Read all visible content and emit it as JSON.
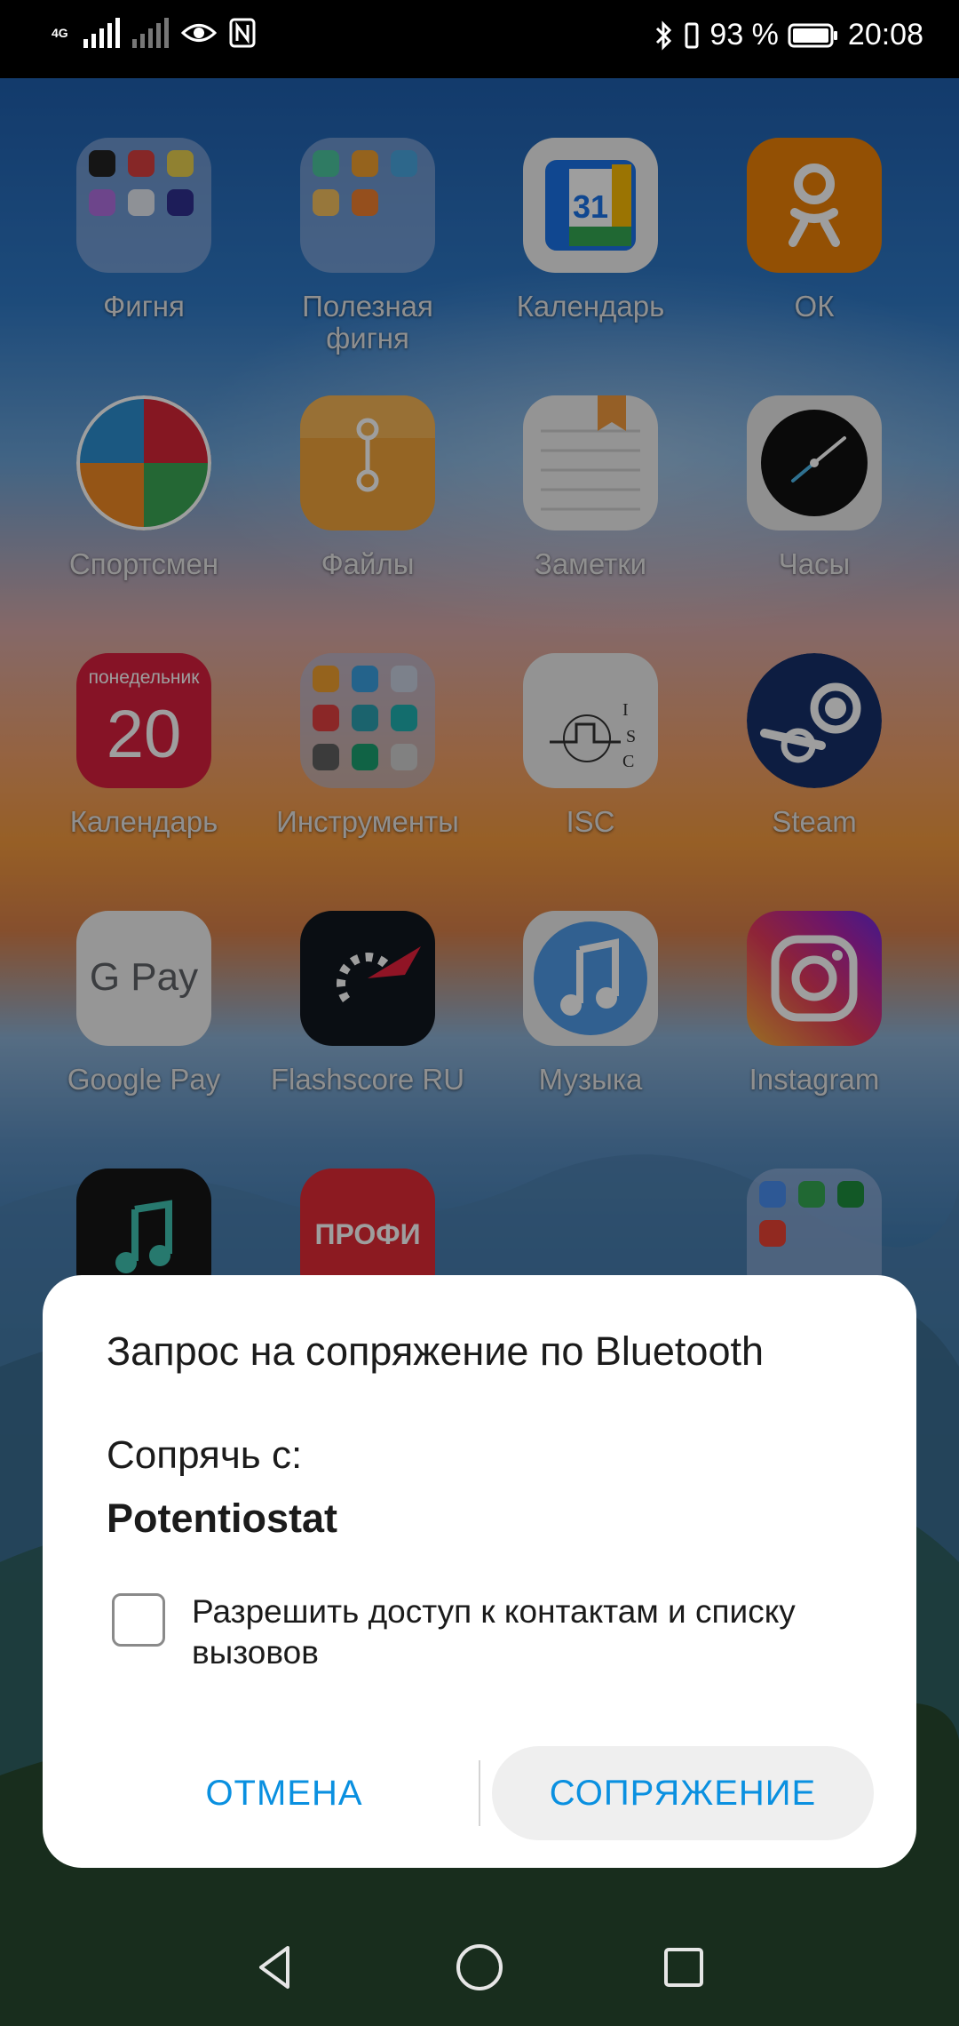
{
  "status_bar": {
    "network_type": "4G",
    "battery_percent": "93 %",
    "time": "20:08",
    "icons": [
      "signal-icon",
      "no-signal-icon",
      "eye-comfort-icon",
      "nfc-icon",
      "bluetooth-icon",
      "vibrate-icon",
      "battery-icon"
    ]
  },
  "apps": [
    {
      "label": "Фигня",
      "icon": "folder-icon"
    },
    {
      "label": "Полезная фигня",
      "icon": "folder-icon"
    },
    {
      "label": "Календарь",
      "icon": "google-calendar-icon",
      "badge": "31"
    },
    {
      "label": "ОК",
      "icon": "odnoklassniki-icon"
    },
    {
      "label": "Спортсмен",
      "icon": "sportsman-icon"
    },
    {
      "label": "Файлы",
      "icon": "files-icon"
    },
    {
      "label": "Заметки",
      "icon": "notes-icon"
    },
    {
      "label": "Часы",
      "icon": "clock-icon"
    },
    {
      "label": "Календарь",
      "icon": "calendar-icon",
      "weekday": "понедельник",
      "day": "20"
    },
    {
      "label": "Инструменты",
      "icon": "folder-icon"
    },
    {
      "label": "ISC",
      "icon": "isc-icon"
    },
    {
      "label": "Steam",
      "icon": "steam-icon"
    },
    {
      "label": "Google Pay",
      "icon": "google-pay-icon",
      "icon_text": "G Pay"
    },
    {
      "label": "Flashscore RU",
      "icon": "flashscore-icon"
    },
    {
      "label": "Музыка",
      "icon": "music-icon"
    },
    {
      "label": "Instagram",
      "icon": "instagram-icon"
    },
    {
      "label": "",
      "icon": "music-player-icon"
    },
    {
      "label": "",
      "icon": "profi-icon",
      "icon_text": "ПРОФИ"
    },
    {
      "label": "",
      "icon": "folder-icon"
    }
  ],
  "dialog": {
    "title": "Запрос на сопряжение по Bluetooth",
    "pair_with_label": "Сопрячь с:",
    "device_name": "Potentiostat",
    "checkbox_label": "Разрешить доступ к контактам и списку вызовов",
    "checkbox_checked": false,
    "cancel_label": "ОТМЕНА",
    "pair_label": "СОПРЯЖЕНИЕ",
    "accent_color": "#0a90e0"
  },
  "nav_bar": {
    "items": [
      "back-icon",
      "home-icon",
      "recents-icon"
    ]
  }
}
